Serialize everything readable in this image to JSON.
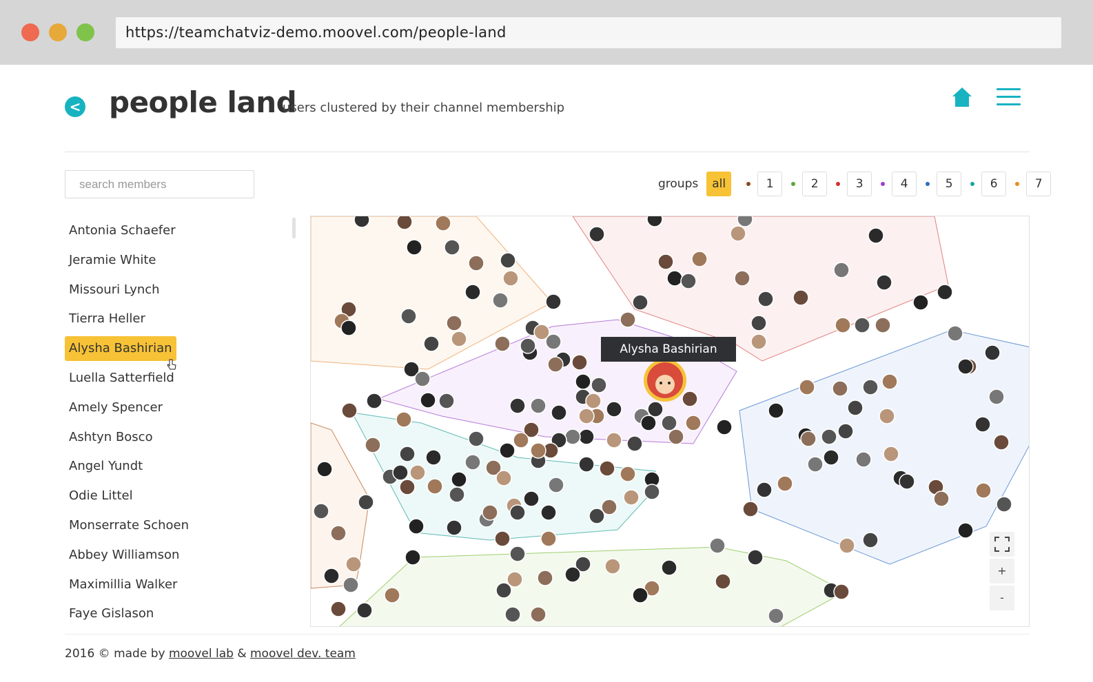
{
  "browser": {
    "url": "https://teamchatviz-demo.moovel.com/people-land"
  },
  "header": {
    "back_glyph": "<",
    "title": "people land",
    "subtitle": "users clustered by their channel membership",
    "home_icon": "home-icon",
    "menu_icon": "hamburger-menu-icon"
  },
  "search": {
    "placeholder": "search members"
  },
  "groups": {
    "label": "groups",
    "all_label": "all",
    "items": [
      {
        "label": "1",
        "color": "#8b4a1c"
      },
      {
        "label": "2",
        "color": "#5aa63c"
      },
      {
        "label": "3",
        "color": "#d0312d"
      },
      {
        "label": "4",
        "color": "#9b3fcf"
      },
      {
        "label": "5",
        "color": "#2a6fbf"
      },
      {
        "label": "6",
        "color": "#17a5a0"
      },
      {
        "label": "7",
        "color": "#ef8a1e"
      }
    ]
  },
  "members": [
    "Antonia Schaefer",
    "Jeramie White",
    "Missouri Lynch",
    "Tierra Heller",
    "Alysha Bashirian",
    "Luella Satterfield",
    "Amely Spencer",
    "Ashtyn Bosco",
    "Angel Yundt",
    "Odie Littel",
    "Monserrate Schoen",
    "Abbey Williamson",
    "Maximillia Walker",
    "Faye Gislason"
  ],
  "selected_member": "Alysha Bashirian",
  "tooltip": {
    "text": "Alysha Bashirian"
  },
  "zoom": {
    "fullscreen_icon": "fullscreen-icon",
    "plus": "+",
    "minus": "-"
  },
  "footer": {
    "prefix": "2016 © made by",
    "link1": "moovel lab",
    "amp": "&",
    "link2": "moovel dev. team"
  }
}
